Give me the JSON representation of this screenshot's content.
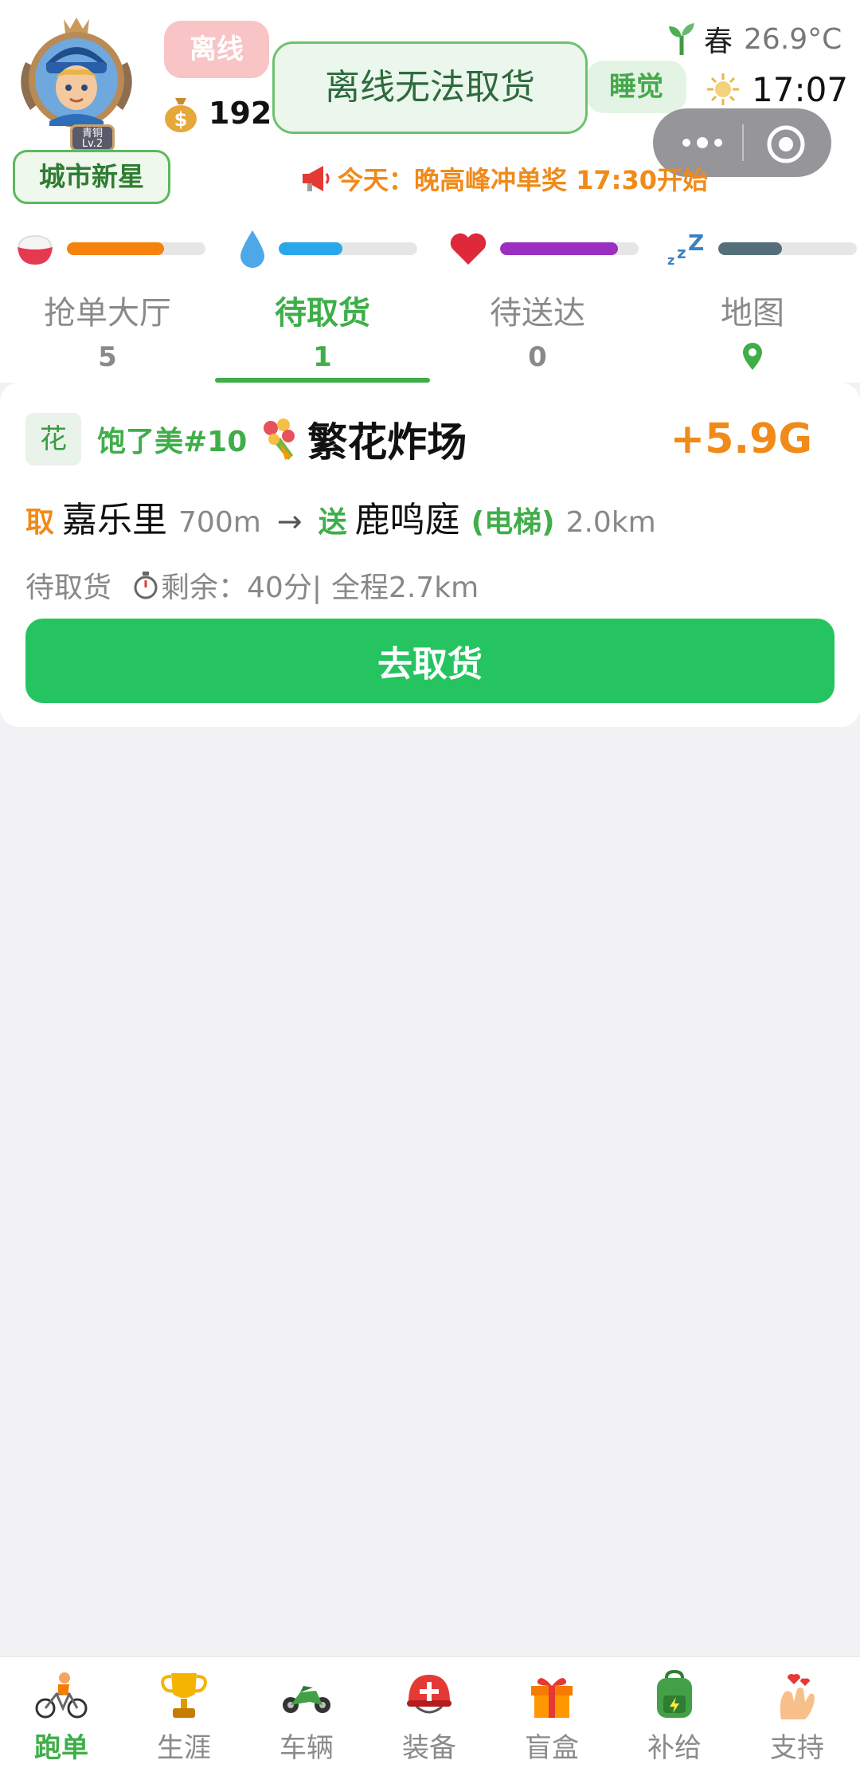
{
  "header": {
    "status_pill": "离线",
    "coins": "192.",
    "rank": "城市新星",
    "avatar": {
      "tier": "青铜",
      "level": "Lv.2"
    },
    "toast": "离线无法取货",
    "sleep_button": "睡觉",
    "season": {
      "name": "春",
      "temperature": "26.9°C",
      "icon": "sprout-icon"
    },
    "clock": {
      "time": "17:07",
      "icon": "sun-icon"
    },
    "notice": "今天：晚高峰冲单奖 17:30开始"
  },
  "stats": [
    {
      "name": "food",
      "icon": "rice-bowl-icon",
      "fraction": 0.7,
      "color": "#f5820d"
    },
    {
      "name": "water",
      "icon": "water-drop-icon",
      "fraction": 0.46,
      "color": "#2aa7e8"
    },
    {
      "name": "health",
      "icon": "heart-icon",
      "fraction": 0.85,
      "color": "#9b2fbf"
    },
    {
      "name": "sleep",
      "icon": "sleep-zzz-icon",
      "fraction": 0.46,
      "color": "#546e7a"
    }
  ],
  "tabs": [
    {
      "label": "抢单大厅",
      "count": "5"
    },
    {
      "label": "待取货",
      "count": "1"
    },
    {
      "label": "待送达",
      "count": "0"
    },
    {
      "label": "地图",
      "icon": "map-pin-icon"
    }
  ],
  "order": {
    "category": "花",
    "shop": "饱了美#10",
    "store_icon": "bouquet-icon",
    "store_name": "繁花炸场",
    "reward": "+5.9G",
    "pickup_tag": "取",
    "pickup_place": "嘉乐里",
    "pickup_distance": "700m",
    "arrow": "→",
    "deliver_tag": "送",
    "deliver_place": "鹿鸣庭",
    "deliver_note": "(电梯)",
    "deliver_distance": "2.0km",
    "status": "待取货",
    "remaining": "剩余：40分|",
    "total": "全程2.7km",
    "button": "去取货"
  },
  "bottom_nav": [
    {
      "label": "跑单",
      "icon": "cyclist-icon"
    },
    {
      "label": "生涯",
      "icon": "trophy-icon"
    },
    {
      "label": "车辆",
      "icon": "motorcycle-icon"
    },
    {
      "label": "装备",
      "icon": "helmet-icon"
    },
    {
      "label": "盲盒",
      "icon": "gift-box-icon"
    },
    {
      "label": "补给",
      "icon": "backpack-icon"
    },
    {
      "label": "支持",
      "icon": "finger-heart-icon"
    }
  ]
}
